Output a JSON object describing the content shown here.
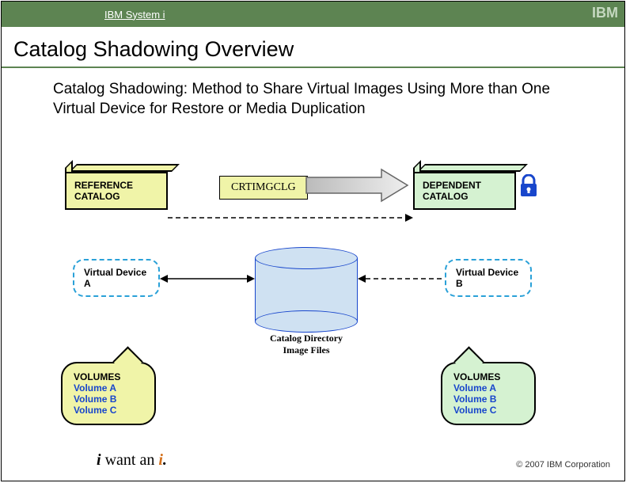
{
  "header": {
    "product": "IBM System i",
    "brand": "IBM"
  },
  "title": "Catalog Shadowing Overview",
  "subtitle": "Catalog Shadowing: Method to Share Virtual Images Using More than One Virtual Device for Restore or Media Duplication",
  "diagram": {
    "reference_catalog": "REFERENCE CATALOG",
    "command": "CRTIMGCLG",
    "dependent_catalog": "DEPENDENT CATALOG",
    "virtual_device_a": "Virtual Device A",
    "virtual_device_b": "Virtual Device B",
    "cylinder_label": "Catalog Directory Image Files",
    "volumes_left": {
      "header": "VOLUMES",
      "items": [
        "Volume A",
        "Volume B",
        "Volume C"
      ]
    },
    "volumes_right": {
      "header": "VOLUMES",
      "items": [
        "Volume A",
        "Volume B",
        "Volume C"
      ]
    }
  },
  "footer": {
    "tagline_i1": "i",
    "tagline_want": "want",
    "tagline_an": "an",
    "tagline_i2": "i",
    "tagline_dot": ".",
    "copyright": "© 2007 IBM Corporation"
  }
}
